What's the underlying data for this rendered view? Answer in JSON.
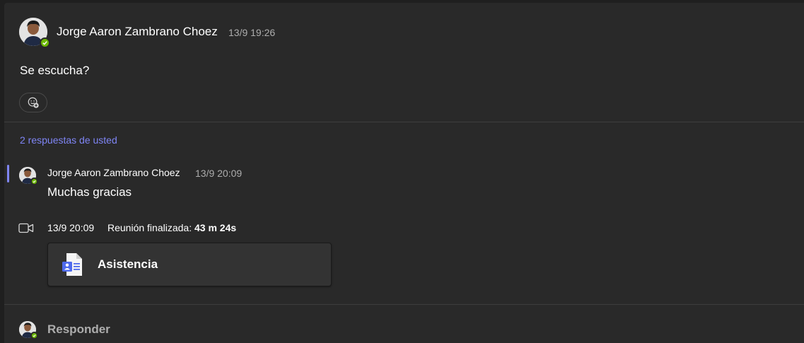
{
  "post": {
    "author": "Jorge Aaron Zambrano Choez",
    "timestamp": "13/9 19:26",
    "message": "Se escucha?",
    "reaction_button_icon": "add-reaction-icon"
  },
  "thread": {
    "replies_summary": "2 respuestas de usted",
    "reply": {
      "author": "Jorge Aaron Zambrano Choez",
      "timestamp": "13/9 20:09",
      "message": "Muchas gracias"
    },
    "meeting": {
      "icon": "video-camera-icon",
      "timestamp": "13/9 20:09",
      "status_label": "Reunión finalizada:",
      "duration": "43 m 24s",
      "attendance_card": {
        "icon": "attendance-report-icon",
        "label": "Asistencia"
      }
    }
  },
  "composer": {
    "placeholder": "Responder"
  },
  "colors": {
    "background": "#292929",
    "accent": "#7f85f5",
    "presence_available": "#6bb700",
    "muted_text": "#adadad"
  }
}
